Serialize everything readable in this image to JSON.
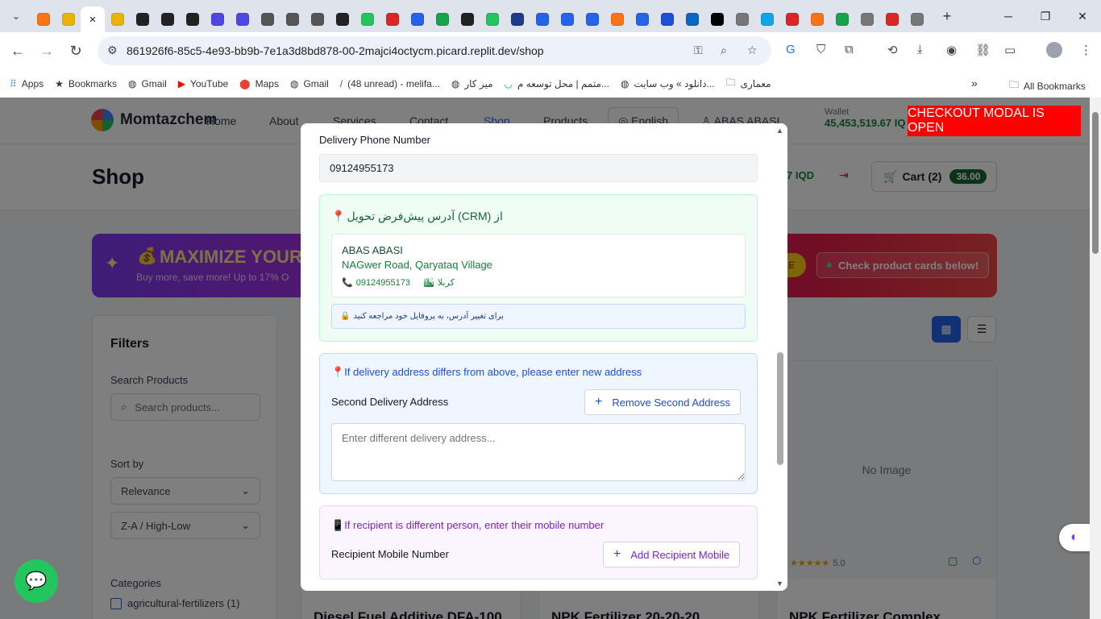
{
  "browser": {
    "tabs": [
      "tab-1",
      "tab-2",
      "tab-3",
      "tab-4",
      "tab-5",
      "tab-6",
      "tab-7",
      "tab-8",
      "tab-9",
      "tab-10",
      "tab-11",
      "tab-12",
      "tab-13",
      "tab-14",
      "tab-15",
      "tab-16",
      "tab-17",
      "tab-18",
      "tab-19",
      "tab-20",
      "tab-21",
      "tab-22",
      "tab-23",
      "tab-24",
      "tab-25",
      "tab-26",
      "tab-27",
      "tab-28",
      "tab-29",
      "tab-30",
      "tab-31",
      "tab-32",
      "tab-33",
      "tab-34",
      "tab-35",
      "tab-36"
    ],
    "url": "861926f6-85c5-4e93-bb9b-7e1a3d8bd878-00-2majci4octycm.picard.replit.dev/shop",
    "bookmarks": [
      {
        "label": "Apps",
        "icon": "apps-grid-icon"
      },
      {
        "label": "Bookmarks",
        "icon": "star-icon"
      },
      {
        "label": "Gmail",
        "icon": "globe-icon"
      },
      {
        "label": "YouTube",
        "icon": "youtube-icon"
      },
      {
        "label": "Maps",
        "icon": "maps-pin-icon"
      },
      {
        "label": "Gmail",
        "icon": "globe-icon"
      },
      {
        "label": "(48 unread) - melifa...",
        "icon": "yahoo-icon"
      },
      {
        "label": "میز کار",
        "icon": "globe-icon"
      },
      {
        "label": "متمم | محل توسعه م...",
        "icon": "mottamem-icon"
      },
      {
        "label": "دانلود » وب سایت...",
        "icon": "globe-icon"
      },
      {
        "label": "معماری",
        "icon": "folder-icon"
      }
    ],
    "all_bookmarks": "All Bookmarks",
    "more_bookmarks": "»"
  },
  "site": {
    "brand": "Momtazchem",
    "nav": [
      "Home",
      "About",
      "Services",
      "Contact",
      "Shop",
      "Products"
    ],
    "language": "English",
    "user": "ABAS ABASI",
    "wallet_label": "Wallet",
    "wallet_amount": "45,453,519.67 IQ",
    "page_title": "Shop",
    "wallet_short": "7 IQD",
    "cart_label": "Cart (2)",
    "cart_total": "36.00",
    "promo_title": "MAXIMIZE YOUR",
    "promo_sub": "Buy more, save more! Up to 17% O",
    "promo_pill": "E",
    "promo_check": "Check product cards below!",
    "filters_title": "Filters",
    "search_label": "Search Products",
    "search_placeholder": "Search products...",
    "sort_label": "Sort by",
    "sort_value": "Relevance",
    "order_value": "Z-A / High-Low",
    "categories_label": "Categories",
    "category_item": "agricultural-fertilizers (1)",
    "no_image": "No Image",
    "rating": "5.0",
    "products": [
      "Diesel Fuel Additive DFA-100",
      "NPK Fertilizer 20-20-20",
      "NPK Fertilizer Complex"
    ]
  },
  "checkout_banner": "CHECKOUT MODAL IS OPEN",
  "modal": {
    "phone_label": "Delivery Phone Number",
    "phone_value": "09124955173",
    "crm_title": "از (CRM) آدرس پیش‌فرض تحویل",
    "crm_name": "ABAS ABASI",
    "crm_address": "NAGwer Road, Qaryataq Village",
    "crm_phone": "09124955173",
    "crm_city": "کربلا",
    "crm_note": "برای تغییر آدرس، به پروفایل خود مراجعه کنید",
    "second_title": "If delivery address differs from above, please enter new address",
    "second_label": "Second Delivery Address",
    "remove_second": "Remove Second Address",
    "second_placeholder": "Enter different delivery address...",
    "recipient_title": "If recipient is different person, enter their mobile number",
    "recipient_label": "Recipient Mobile Number",
    "add_recipient": "Add Recipient Mobile"
  },
  "colors": {
    "brand_green": "#166534",
    "checkout_red": "#ff0000",
    "link_blue": "#1d4ed8",
    "purple": "#7e22ce"
  }
}
